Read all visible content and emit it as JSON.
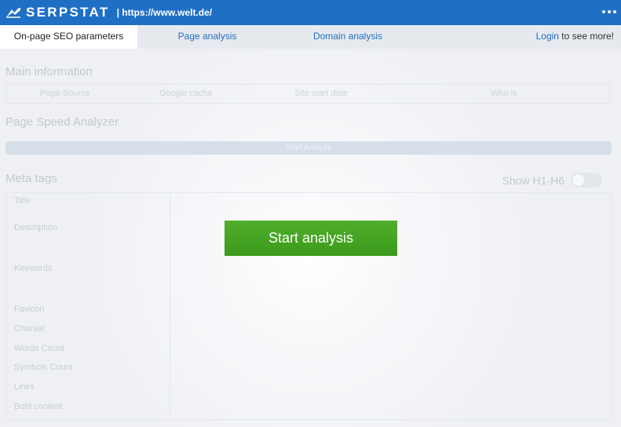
{
  "header": {
    "brand": "SERPSTAT",
    "url": "| https://www.welt.de/"
  },
  "tabs": [
    {
      "label": "On-page SEO parameters",
      "active": true
    },
    {
      "label": "Page analysis",
      "active": false
    },
    {
      "label": "Domain analysis",
      "active": false
    }
  ],
  "login": {
    "link": "Login",
    "suffix": " to see more!"
  },
  "main_info": {
    "title": "Main information",
    "items": [
      "Page Source",
      "Google cache",
      "Site start date",
      "Who is"
    ]
  },
  "page_speed": {
    "title": "Page Speed Analyzer",
    "button": "Start Analyze"
  },
  "meta_tags": {
    "title": "Meta tags",
    "toggle_label": "Show H1-H6",
    "rows": [
      "Title",
      "Description",
      "Keywords",
      "Favicon",
      "Charset",
      "Words Count",
      "Symbols Count",
      "Links",
      "Bold content"
    ]
  },
  "overlay": {
    "button": "Start analysis"
  },
  "colors": {
    "accent": "#1f6fc5",
    "button_green": "#45a323"
  }
}
